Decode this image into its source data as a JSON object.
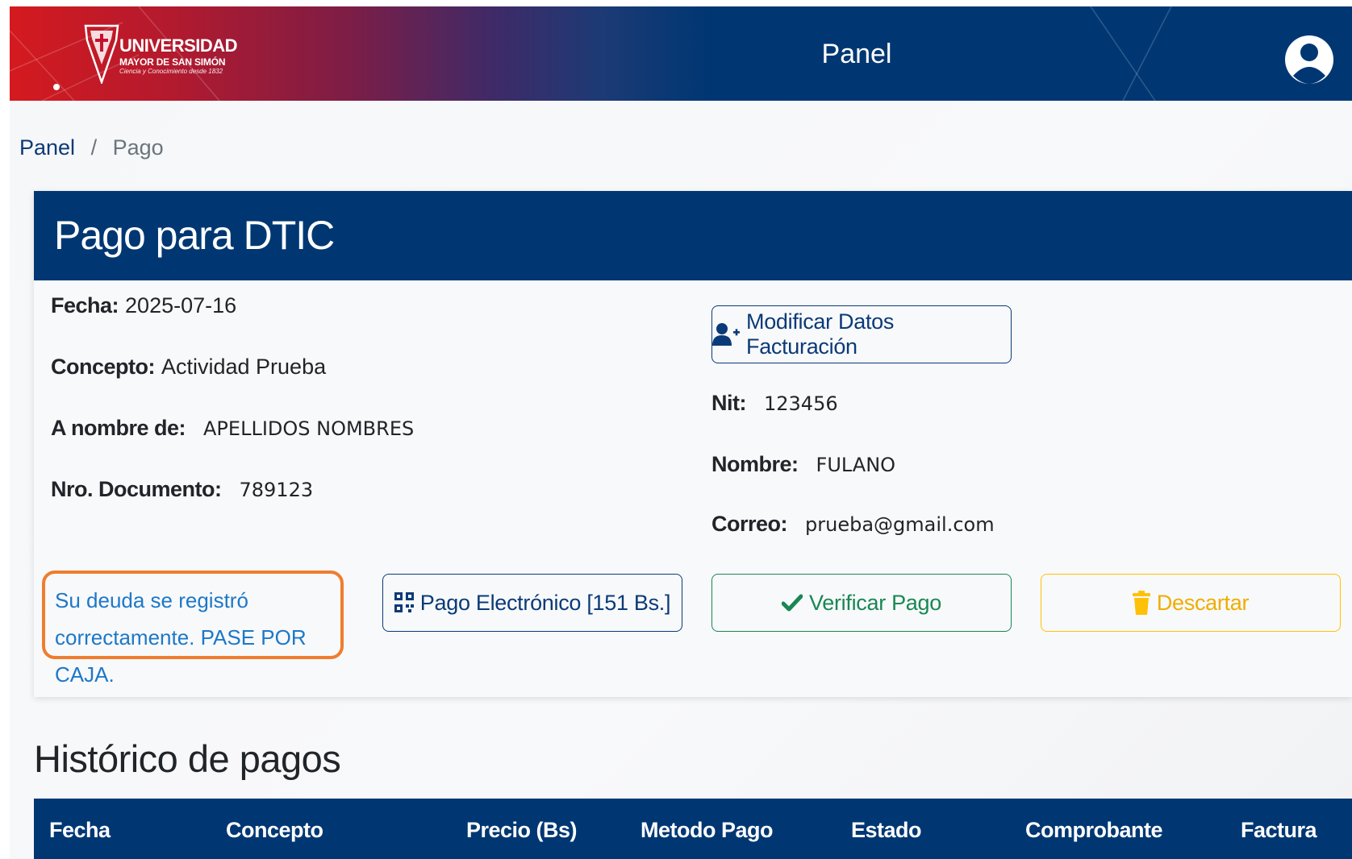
{
  "header": {
    "logo": {
      "line1": "UNIVERSIDAD",
      "line2": "MAYOR DE SAN SIMÓN",
      "line3": "Ciencia y Conocimiento desde 1832"
    },
    "title": "Panel",
    "user_icon": "user-circle-icon"
  },
  "breadcrumb": {
    "items": [
      {
        "label": "Panel",
        "link": true
      },
      {
        "label": "Pago",
        "link": false
      }
    ],
    "separator": "/"
  },
  "payment_card": {
    "title": "Pago para DTIC",
    "left_fields": [
      {
        "label": "Fecha:",
        "value": "2025-07-16"
      },
      {
        "label": "Concepto:",
        "value": "Actividad Prueba"
      },
      {
        "label": "A nombre de:",
        "value": "APELLIDOS NOMBRES"
      },
      {
        "label": "Nro. Documento:",
        "value": "789123"
      }
    ],
    "right_fields": [
      {
        "label": "Nit:",
        "value": "123456"
      },
      {
        "label": "Nombre:",
        "value": "FULANO"
      },
      {
        "label": "Correo:",
        "value": "prueba@gmail.com"
      }
    ],
    "modify_button": {
      "label": "Modificar Datos Facturación",
      "icon": "user-plus-icon"
    },
    "message": "Su deuda se registró correctamente. PASE POR CAJA.",
    "buttons": {
      "electronic_payment": {
        "label": "Pago Electrónico [151 Bs.]",
        "icon": "qr-code-icon"
      },
      "verify_payment": {
        "label": "Verificar Pago",
        "icon": "check-icon"
      },
      "discard": {
        "label": "Descartar",
        "icon": "trash-icon"
      }
    }
  },
  "history": {
    "title": "Histórico de pagos",
    "columns": [
      "Fecha",
      "Concepto",
      "Precio (Bs)",
      "Metodo Pago",
      "Estado",
      "Comprobante",
      "Factura"
    ]
  },
  "colors": {
    "navy": "#003773",
    "brand_red": "#d41a1f",
    "success": "#198754",
    "warning": "#ffc107",
    "highlight_orange": "#ef7d2f",
    "info_text": "#1d78c8"
  }
}
